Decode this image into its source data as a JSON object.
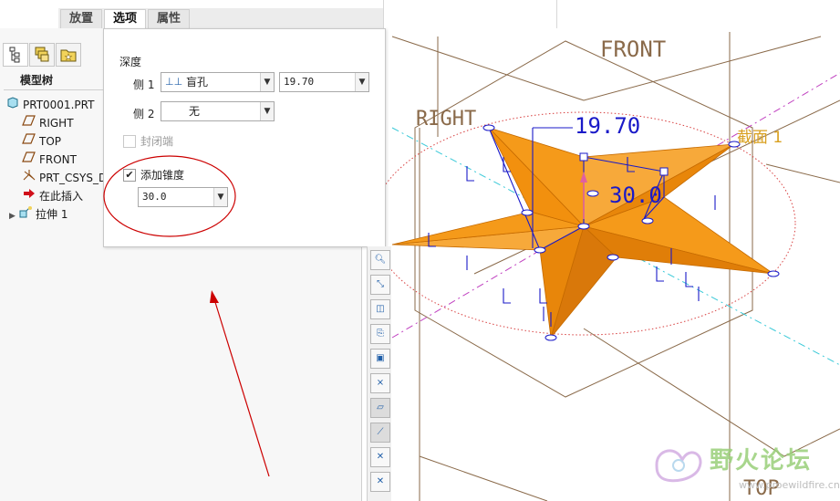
{
  "tabs": [
    {
      "label": "放置",
      "active": false
    },
    {
      "label": "选项",
      "active": true
    },
    {
      "label": "属性",
      "active": false
    }
  ],
  "model_tree": {
    "header": "模型树",
    "items": [
      {
        "label": "PRT0001.PRT",
        "icon": "part-icon"
      },
      {
        "label": "RIGHT",
        "icon": "datum-plane-icon"
      },
      {
        "label": "TOP",
        "icon": "datum-plane-icon"
      },
      {
        "label": "FRONT",
        "icon": "datum-plane-icon"
      },
      {
        "label": "PRT_CSYS_D",
        "icon": "csys-icon"
      },
      {
        "label": "在此插入",
        "icon": "insert-arrow-icon"
      },
      {
        "label": "拉伸 1",
        "icon": "extrude-icon"
      }
    ]
  },
  "options": {
    "depth_label": "深度",
    "side1_label": "侧 1",
    "side1_type": "盲孔",
    "side1_value": "19.70",
    "side2_label": "侧 2",
    "side2_type": "无",
    "capped_label": "封闭端",
    "capped_checked": false,
    "taper_label": "添加锥度",
    "taper_checked": true,
    "taper_value": "30.0"
  },
  "viewport": {
    "plane_labels": {
      "front": "FRONT",
      "right": "RIGHT",
      "top": "TOP",
      "section": "截面 1"
    },
    "dims": {
      "depth": "19.70",
      "taper": "30.0"
    },
    "colors": {
      "shape": "#f28a06",
      "shape_edge": "#c56a00",
      "datum": "#8a6a4a",
      "sketch": "#1a1ac8",
      "axis_cyan": "#39c9d8",
      "axis_magenta": "#c040c0",
      "annotation_red": "#cc0000"
    }
  },
  "watermark": {
    "text": "野火论坛",
    "url": "www.proewildfire.cn"
  }
}
